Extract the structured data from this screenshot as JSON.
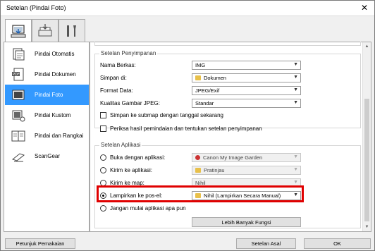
{
  "window": {
    "title": "Setelan (Pindai Foto)",
    "close_glyph": "✕"
  },
  "tabs": [
    {
      "name": "scan-from-computer-tab",
      "icon": "computer-scan-icon",
      "active": true
    },
    {
      "name": "scan-from-panel-tab",
      "icon": "device-scan-icon",
      "active": false
    },
    {
      "name": "general-settings-tab",
      "icon": "tools-icon",
      "active": false
    }
  ],
  "nav": {
    "items": [
      {
        "label": "Pindai Otomatis",
        "icon": "auto-scan-icon"
      },
      {
        "label": "Pindai Dokumen",
        "icon": "pdf-document-icon"
      },
      {
        "label": "Pindai Foto",
        "icon": "photo-icon",
        "active": true
      },
      {
        "label": "Pindai Kustom",
        "icon": "custom-scan-icon"
      },
      {
        "label": "Pindai dan Rangkai",
        "icon": "stitch-icon"
      },
      {
        "label": "ScanGear",
        "icon": "scangear-icon"
      }
    ]
  },
  "save": {
    "group_title": "Setelan Penyimpanan",
    "filename_label": "Nama Berkas:",
    "filename_value": "IMG",
    "save_in_label": "Simpan di:",
    "save_in_value": "Dokumen",
    "format_label": "Format Data:",
    "format_value": "JPEG/Exif",
    "jpeg_label": "Kualitas Gambar JPEG:",
    "jpeg_value": "Standar",
    "subfolder_label": "Simpan ke submap dengan tanggal sekarang",
    "check_results_label": "Periksa hasil pemindaian dan tentukan setelan penyimpanan"
  },
  "app": {
    "group_title": "Setelan Aplikasi",
    "open_with_label": "Buka dengan aplikasi:",
    "open_with_value": "Canon My Image Garden",
    "send_app_label": "Kirim ke aplikasi:",
    "send_app_value": "Pratinjau",
    "send_folder_label": "Kirim ke map:",
    "send_folder_value": "Nihil",
    "attach_email_label": "Lampirkan ke pos-el:",
    "attach_email_value": "Nihil (Lampirkan Secara Manual)",
    "do_not_start_label": "Jangan mulai aplikasi apa pun",
    "more_functions_label": "Lebih Banyak Fungsi"
  },
  "footer": {
    "instructions_label": "Petunjuk Pemakaian",
    "defaults_label": "Setelan Asal",
    "ok_label": "OK"
  },
  "colors": {
    "selection": "#3399ff",
    "highlight_box": "#e00000"
  }
}
